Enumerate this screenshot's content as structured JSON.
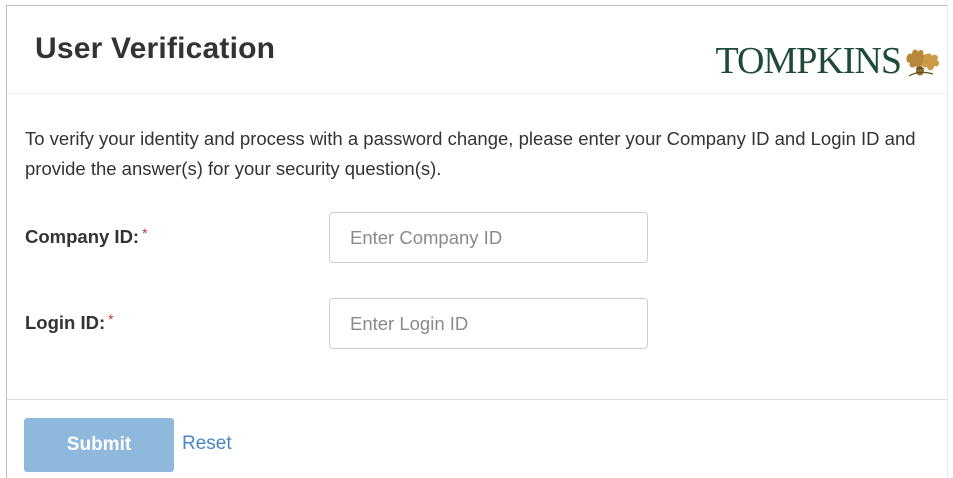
{
  "header": {
    "title": "User Verification",
    "logo_text": "TOMPKINS"
  },
  "intro": {
    "text": "To verify your identity and process with a password change, please enter your Company ID and Login ID and provide the answer(s) for your security question(s)."
  },
  "form": {
    "company_id": {
      "label": "Company ID:",
      "required_mark": "*",
      "placeholder": "Enter Company ID",
      "value": ""
    },
    "login_id": {
      "label": "Login ID:",
      "required_mark": "*",
      "placeholder": "Enter Login ID",
      "value": ""
    }
  },
  "actions": {
    "submit_label": "Submit",
    "reset_label": "Reset"
  },
  "colors": {
    "brand": "#1f4a36",
    "leaf_accent": "#b8893a",
    "submit_bg": "#8fb8dd",
    "link": "#4a86c5",
    "required": "#c9302c"
  },
  "icons": {
    "logo_mark": "oak-leaf-acorn-icon"
  }
}
